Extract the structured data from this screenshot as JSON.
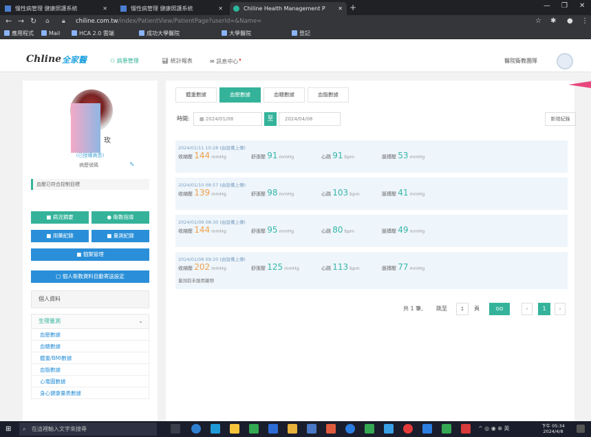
{
  "browser": {
    "tabs": [
      {
        "label": "慢性病管理 健康照護系統"
      },
      {
        "label": "慢性病管理 健康照護系統"
      },
      {
        "label": "Chiline Health Management P"
      }
    ],
    "new_tab": "+",
    "url_host": "chiline.com.tw",
    "url_rest": "/index/PatientView/PatientPage?userId=&Name=",
    "bookmarks": [
      "應用程式",
      "Mail",
      "HCA 2.0 雲端",
      "成功大學醫院",
      "大學醫院",
      "登記"
    ]
  },
  "site": {
    "logo": "Chline",
    "logo_cn": "全家醫",
    "nav": [
      {
        "label": "病患管理"
      },
      {
        "label": "統計報表"
      },
      {
        "label": "訊息中心"
      }
    ],
    "org_name": "醫院衛教團隊"
  },
  "sidebar": {
    "name_char": "玫",
    "sub_link": "(已授權病患)",
    "info_label": "病歷號碼",
    "edit_icon_char": "✎",
    "note": "血壓已符合控制目標",
    "buttons": [
      {
        "label": "■ 病況摘要"
      },
      {
        "label": "● 衛教指導"
      },
      {
        "label": "■ 用藥紀錄"
      },
      {
        "label": "■ 量測紀錄"
      },
      {
        "label": "■ 個案管理"
      },
      {
        "label": "□ 個人衛教資料自動寄送設定"
      }
    ],
    "menu_header": "個人資料",
    "menu_accordion": "生理量測",
    "menu_chevron": "⌄",
    "menu_items": [
      "血壓數據",
      "血糖數據",
      "體重/BMI數據",
      "血脂數據",
      "心電圖數據",
      "身心健康量表數據"
    ]
  },
  "main": {
    "tabs": [
      {
        "label": "體重數據"
      },
      {
        "label": "血壓數據"
      },
      {
        "label": "血糖數據"
      },
      {
        "label": "血脂數據"
      }
    ],
    "filter_label": "時間:",
    "date_from": "2024/01/08",
    "date_to": "2024/04/08",
    "date_sep": "至",
    "add_button": "新增紀錄",
    "labels": {
      "sys": "收縮壓",
      "dia": "舒張壓",
      "pulse": "心跳",
      "pp": "脈搏壓"
    },
    "units": {
      "mmhg": "mmHg",
      "bpm": "bpm"
    },
    "records": [
      {
        "date": "2024/01/11 10:28 (由設備上傳)",
        "sys": "144",
        "dia": "91",
        "pulse": "91",
        "pp": "53",
        "note": ""
      },
      {
        "date": "2024/01/10 08:57 (由設備上傳)",
        "sys": "139",
        "dia": "98",
        "pulse": "103",
        "pp": "41",
        "note": ""
      },
      {
        "date": "2024/01/09 08:30 (由設備上傳)",
        "sys": "144",
        "dia": "95",
        "pulse": "80",
        "pp": "49",
        "note": ""
      },
      {
        "date": "2024/01/08 09:20 (由設備上傳)",
        "sys": "202",
        "dia": "125",
        "pulse": "113",
        "pp": "77",
        "note": "量測前未服用藥物"
      }
    ],
    "pager": {
      "total_text": "共 1 筆,",
      "goto": "跳至",
      "page_value": "1",
      "page_suffix": "頁",
      "go": "GO",
      "prev": "‹",
      "current": "1",
      "next": "›"
    }
  },
  "taskbar": {
    "search_placeholder": "在這裡輸入文字來搜尋",
    "time": "下午 05:34",
    "date": "2024/4/8",
    "tray": "^ ◎ ◉ ⊕ 英"
  },
  "colors": {
    "accent": "#34b39a",
    "blue": "#2a8fd8",
    "orange": "#f0a04b",
    "teal": "#35b7a8"
  }
}
